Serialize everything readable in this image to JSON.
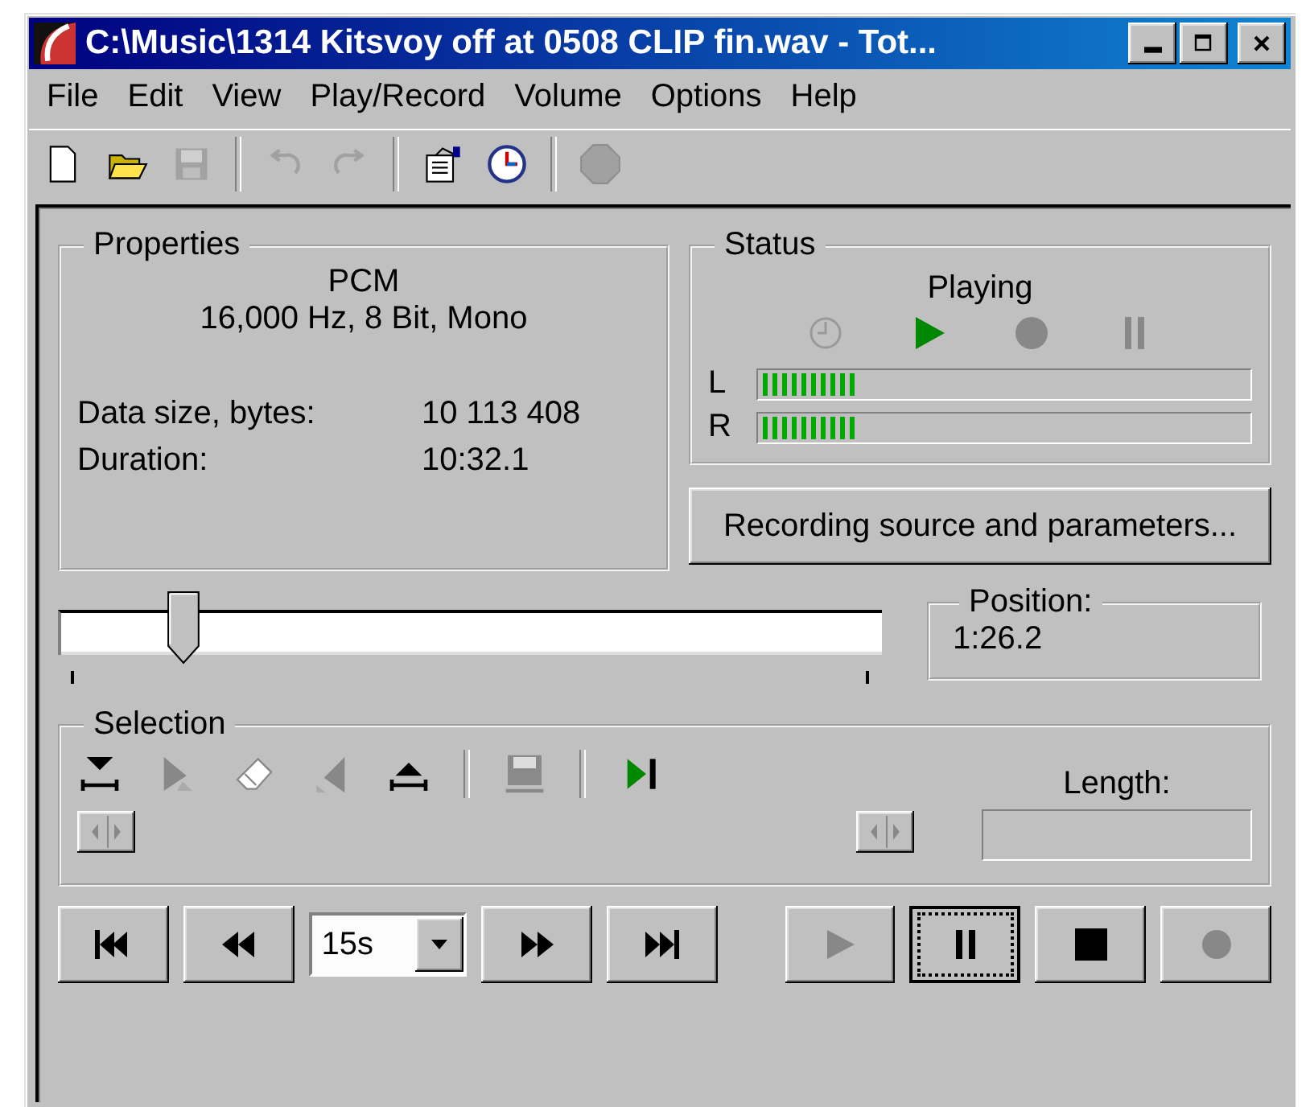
{
  "window": {
    "title": "C:\\Music\\1314 Kitsvoy off at 0508 CLIP fin.wav - Tot..."
  },
  "menu": [
    {
      "label": "File"
    },
    {
      "label": "Edit"
    },
    {
      "label": "View"
    },
    {
      "label": "Play/Record"
    },
    {
      "label": "Volume"
    },
    {
      "label": "Options"
    },
    {
      "label": "Help"
    }
  ],
  "toolbar": [
    {
      "kind": "new",
      "disabled": false
    },
    {
      "kind": "open",
      "disabled": false
    },
    {
      "kind": "save",
      "disabled": true
    },
    {
      "kind": "sep"
    },
    {
      "kind": "undo",
      "disabled": true
    },
    {
      "kind": "redo",
      "disabled": true
    },
    {
      "kind": "sep"
    },
    {
      "kind": "properties",
      "disabled": false
    },
    {
      "kind": "timer",
      "disabled": false
    },
    {
      "kind": "sep"
    },
    {
      "kind": "stop",
      "disabled": true
    }
  ],
  "properties": {
    "title": "Properties",
    "format": "PCM",
    "params": "16,000 Hz, 8 Bit, Mono",
    "rows": [
      {
        "label": "Data size, bytes:",
        "value": "10 113 408"
      },
      {
        "label": "Duration:",
        "value": "10:32.1"
      }
    ]
  },
  "status": {
    "title": "Status",
    "state": "Playing",
    "indicators": [
      {
        "kind": "timer",
        "on": false
      },
      {
        "kind": "play",
        "on": true
      },
      {
        "kind": "record",
        "on": false
      },
      {
        "kind": "pause",
        "on": false
      }
    ],
    "meters": [
      {
        "label": "L",
        "level": 0.2
      },
      {
        "label": "R",
        "level": 0.2
      }
    ]
  },
  "recording_button": "Recording source and parameters...",
  "position": {
    "title": "Position:",
    "value": "1:26.2"
  },
  "selection": {
    "title": "Selection",
    "tools": [
      {
        "kind": "mark-start",
        "disabled": false
      },
      {
        "kind": "play-selection",
        "disabled": true
      },
      {
        "kind": "eraser",
        "disabled": true
      },
      {
        "kind": "mark-left",
        "disabled": true
      },
      {
        "kind": "mark-end",
        "disabled": false
      },
      {
        "kind": "sep"
      },
      {
        "kind": "save",
        "disabled": true
      },
      {
        "kind": "sep"
      },
      {
        "kind": "play-end",
        "disabled": false
      }
    ],
    "length_label": "Length:"
  },
  "transport": {
    "step": "15s",
    "buttons": [
      {
        "kind": "first",
        "disabled": false,
        "focused": false
      },
      {
        "kind": "rewind",
        "disabled": false,
        "focused": false
      },
      {
        "kind": "step"
      },
      {
        "kind": "forward",
        "disabled": false,
        "focused": false
      },
      {
        "kind": "last",
        "disabled": false,
        "focused": false
      },
      {
        "kind": "gap"
      },
      {
        "kind": "play",
        "disabled": true,
        "focused": false
      },
      {
        "kind": "pause",
        "disabled": false,
        "focused": true
      },
      {
        "kind": "stop",
        "disabled": false,
        "focused": false
      },
      {
        "kind": "record",
        "disabled": true,
        "focused": false
      }
    ]
  }
}
